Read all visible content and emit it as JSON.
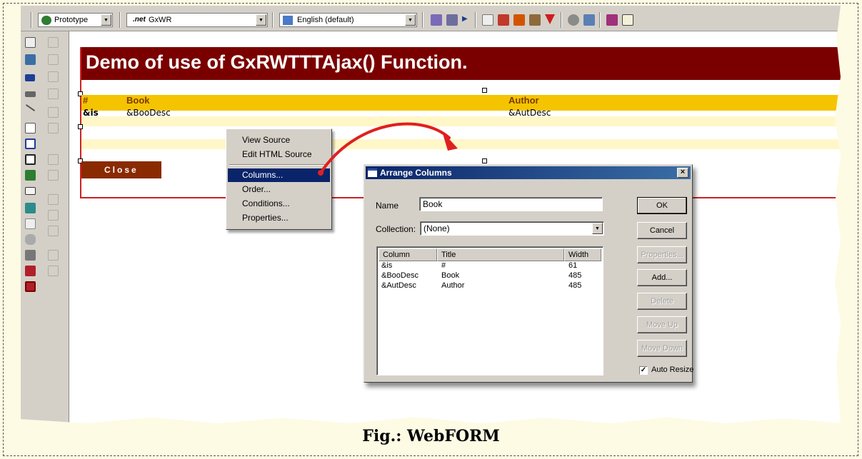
{
  "toolbar": {
    "model_combo": "Prototype",
    "object_combo": "GxWR",
    "object_prefix": ".net",
    "language_combo": "English (default)"
  },
  "form": {
    "title": "Demo of use of GxRWTTTAjax() Function.",
    "grid_headers": [
      "#",
      "Book",
      "Author"
    ],
    "grid_row": [
      "&is",
      "&BooDesc",
      "&AutDesc"
    ],
    "close_label": "Close"
  },
  "context_menu": {
    "items": [
      "View Source",
      "Edit HTML Source",
      "Columns...",
      "Order...",
      "Conditions...",
      "Properties..."
    ],
    "selected": "Columns..."
  },
  "dialog": {
    "title": "Arrange Columns",
    "close_glyph": "×",
    "name_label": "Name",
    "name_value": "Book",
    "collection_label": "Collection:",
    "collection_value": "(None)",
    "columns_header": [
      "Column",
      "Title",
      "Width"
    ],
    "rows": [
      {
        "column": "&is",
        "title": "#",
        "width": "61"
      },
      {
        "column": "&BooDesc",
        "title": "Book",
        "width": "485"
      },
      {
        "column": "&AutDesc",
        "title": "Author",
        "width": "485"
      }
    ],
    "buttons": [
      "OK",
      "Cancel",
      "Properties...",
      "Add...",
      "Delete",
      "Move Up",
      "Move Down"
    ],
    "auto_resize_label": "Auto Resize",
    "auto_resize_checked": true
  },
  "caption": "Fig.: WebFORM",
  "colors": {
    "title_bg": "#7a0000",
    "grid_header_bg": "#f5c400",
    "arrow": "#e02020",
    "selection": "#0a246a"
  }
}
